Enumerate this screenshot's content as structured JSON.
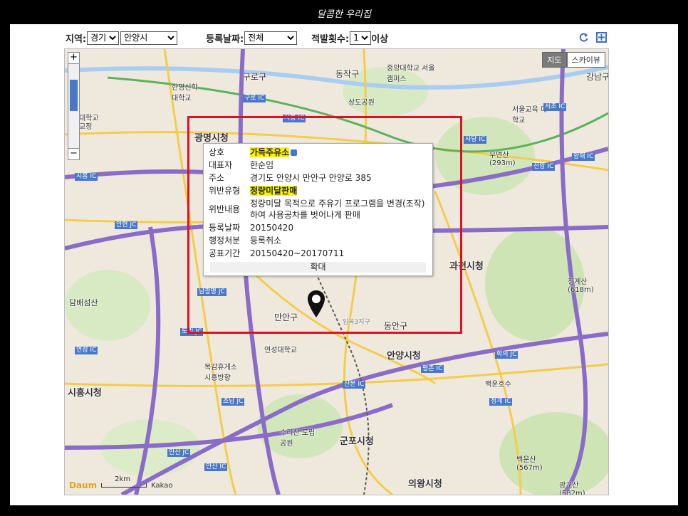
{
  "app_title": "달콤한 우리집",
  "filters": {
    "region_label": "지역:",
    "region_province": "경기",
    "region_city": "안양시",
    "date_label": "등록날짜:",
    "date_value": "전체",
    "count_label": "적발횟수:",
    "count_value": "1",
    "count_suffix": "이상"
  },
  "toolbar_icons": [
    "refresh-icon",
    "fullscreen-icon"
  ],
  "map": {
    "type_tabs": [
      {
        "label": "지도",
        "active": true
      },
      {
        "label": "스카이뷰",
        "active": false
      }
    ],
    "zoom_in": "+",
    "zoom_out": "−",
    "scale_label": "2km",
    "logo": "Daum",
    "provider": "Kakao",
    "places": [
      {
        "name": "구로구"
      },
      {
        "name": "동작구"
      },
      {
        "name": "중앙대학교 서울캠퍼스"
      },
      {
        "name": "한영신학 대학교"
      },
      {
        "name": "상도공원"
      },
      {
        "name": "광명시청",
        "big": true
      },
      {
        "name": "서울교육 대학교"
      },
      {
        "name": "강남구"
      },
      {
        "name": "우면산 (293m)"
      },
      {
        "name": "과천시청",
        "big": true
      },
      {
        "name": "청계산 (618m)"
      },
      {
        "name": "담배섬산"
      },
      {
        "name": "만안구"
      },
      {
        "name": "동안구"
      },
      {
        "name": "임곡3지구"
      },
      {
        "name": "연성대학교"
      },
      {
        "name": "안양시청",
        "big": true
      },
      {
        "name": "목감휴게소 시흥방향"
      },
      {
        "name": "시흥시청",
        "big": true
      },
      {
        "name": "백운호수"
      },
      {
        "name": "수리산 도립공원"
      },
      {
        "name": "군포시청",
        "big": true
      },
      {
        "name": "백운산 (567m)"
      },
      {
        "name": "의왕시청",
        "big": true
      },
      {
        "name": "광교산 (582m)"
      },
      {
        "name": "대학교"
      },
      {
        "name": "교정"
      }
    ],
    "interchanges": [
      "구로 IC",
      "시흥 IC",
      "서초 IC",
      "사당 IC",
      "양재 IC",
      "선암 IC",
      "시흥 IC",
      "안현 JC",
      "남광명 JC",
      "도리 JC",
      "평촌 IC",
      "학의 JC",
      "산본 IC",
      "조남 JC",
      "청계 IC",
      "연성 IC",
      "안산 JC",
      "안산 IC"
    ],
    "route_numbers": [
      "88",
      "1",
      "110",
      "42",
      "47",
      "330",
      "57",
      "100",
      "50",
      "309",
      "1"
    ]
  },
  "info_window": {
    "rows": [
      {
        "key": "상호",
        "value": "가득주유소",
        "highlight": true,
        "badge": true
      },
      {
        "key": "대표자",
        "value": "한순임"
      },
      {
        "key": "주소",
        "value": "경기도 안양시 만안구 안양로 385"
      },
      {
        "key": "위반유형",
        "value": "정량미달판매",
        "highlight": true
      },
      {
        "key": "위반내용",
        "value": "정량미달 목적으로 주유기 프로그램을 변경(조작)하여 사용공차를 벗어나게 판매"
      },
      {
        "key": "등록날짜",
        "value": "20150420"
      },
      {
        "key": "행정처분",
        "value": "등록취소"
      },
      {
        "key": "공표기간",
        "value": "20150420~20170711"
      }
    ],
    "expand_label": "확대"
  },
  "colors": {
    "highlight": "#fdf300",
    "red_box": "#e01020",
    "road_purple": "#8a6cc8",
    "road_yellow": "#f3cd4a",
    "park_green": "#c8e2b0",
    "ic_blue": "#4a78c8"
  }
}
